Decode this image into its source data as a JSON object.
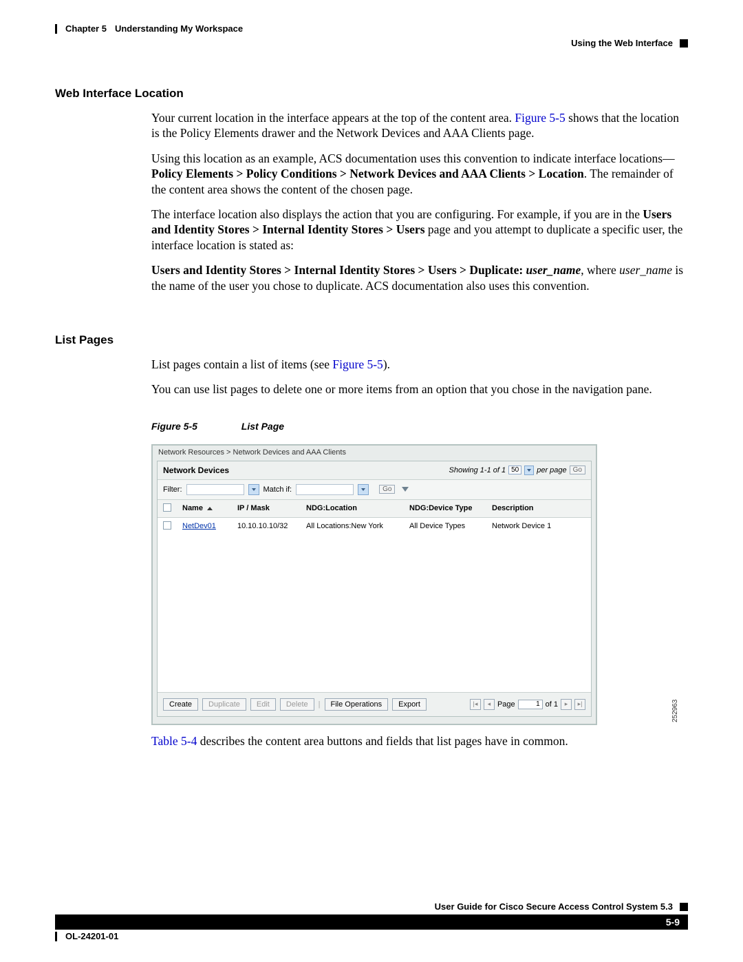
{
  "header": {
    "chapter": "Chapter 5",
    "title": "Understanding My Workspace",
    "subtitle": "Using the Web Interface"
  },
  "sections": {
    "webInterface": {
      "heading": "Web Interface Location",
      "p1_a": "Your current location in the interface appears at the top of the content area. ",
      "p1_link": "Figure 5-5",
      "p1_b": " shows that the location is the Policy Elements drawer and the Network Devices and AAA Clients page.",
      "p2_a": "Using this location as an example, ACS documentation uses this convention to indicate interface locations—",
      "p2_bold": "Policy Elements > Policy Conditions > Network Devices and AAA Clients > Location",
      "p2_b": ". The remainder of the content area shows the content of the chosen page.",
      "p3_a": "The interface location also displays the action that you are configuring. For example, if you are in the ",
      "p3_bold": "Users and Identity Stores > Internal Identity Stores > Users",
      "p3_b": " page and you attempt to duplicate a specific user, the interface location is stated as:",
      "p4_bold": "Users and Identity Stores > Internal Identity Stores > Users > Duplicate: ",
      "p4_ital": "user_name",
      "p4_a": ", where ",
      "p4_ital2": "user_name",
      "p4_b": " is the name of the user you chose to duplicate. ACS documentation also uses this convention."
    },
    "listPages": {
      "heading": "List Pages",
      "p1_a": "List pages contain a list of items (see ",
      "p1_link": "Figure 5-5",
      "p1_b": ").",
      "p2": "You can use list pages to delete one or more items from an option that you chose in the navigation pane.",
      "after_a": "",
      "after_link": "Table 5-4",
      "after_b": " describes the content area buttons and fields that list pages have in common."
    }
  },
  "figure": {
    "num": "Figure 5-5",
    "title": "List Page",
    "sideNum": "252963",
    "breadcrumb": "Network Resources > Network Devices and AAA Clients",
    "panelTitle": "Network Devices",
    "showing": "Showing 1-1 of 1",
    "perPageVal": "50",
    "perPageLbl": "per page",
    "goBtn": "Go",
    "filterLbl": "Filter:",
    "matchLbl": "Match if:",
    "cols": {
      "name": "Name",
      "ip": "IP / Mask",
      "loc": "NDG:Location",
      "dev": "NDG:Device Type",
      "desc": "Description"
    },
    "row": {
      "name": "NetDev01",
      "ip": "10.10.10.10/32",
      "loc": "All Locations:New York",
      "dev": "All Device Types",
      "desc": "Network Device 1"
    },
    "buttons": {
      "create": "Create",
      "duplicate": "Duplicate",
      "edit": "Edit",
      "delete": "Delete",
      "fileOps": "File Operations",
      "export": "Export"
    },
    "pager": {
      "pageLbl": "Page",
      "pageVal": "1",
      "ofLbl": "of 1"
    }
  },
  "footer": {
    "guide": "User Guide for Cisco Secure Access Control System 5.3",
    "docnum": "OL-24201-01",
    "pagenum": "5-9"
  }
}
